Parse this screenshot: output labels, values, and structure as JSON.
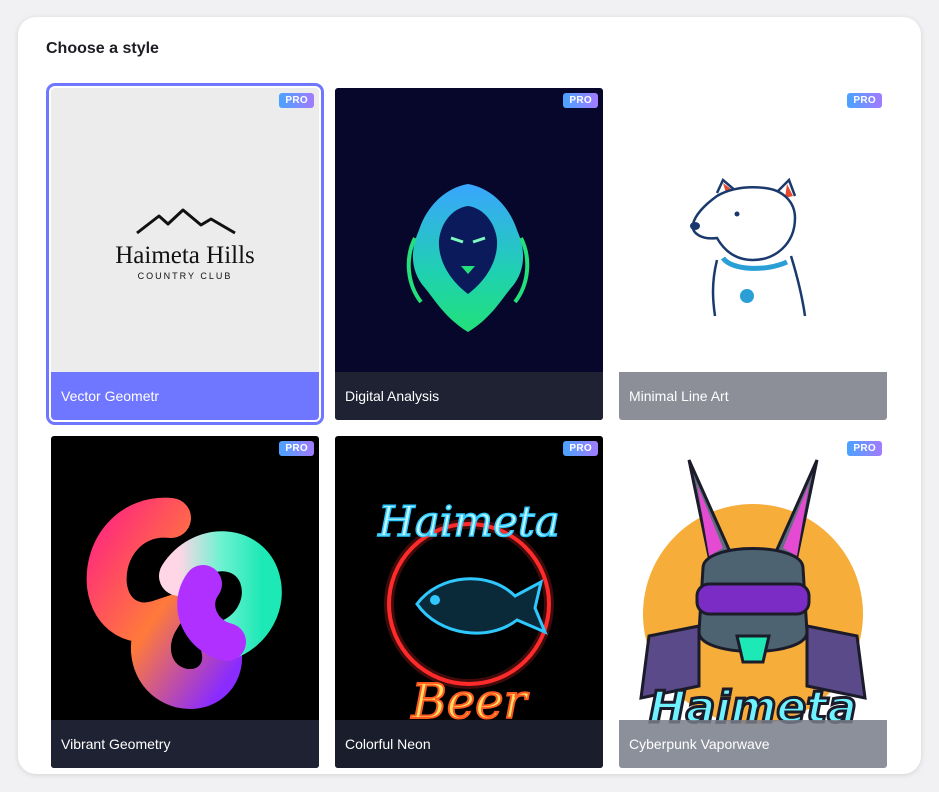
{
  "header": {
    "title": "Choose a style"
  },
  "badge": "PRO",
  "styles": [
    {
      "label": "Vector Geometr",
      "pro": true,
      "selected": true,
      "art_text_1": "Haimeta Hills",
      "art_text_2": "COUNTRY CLUB"
    },
    {
      "label": "Digital Analysis",
      "pro": true,
      "selected": false
    },
    {
      "label": "Minimal Line Art",
      "pro": true,
      "selected": false
    },
    {
      "label": "Vibrant Geometry",
      "pro": true,
      "selected": false
    },
    {
      "label": "Colorful Neon",
      "pro": true,
      "selected": false,
      "art_text_1": "Haimeta",
      "art_text_2": "Beer"
    },
    {
      "label": "Cyberpunk Vaporwave",
      "pro": true,
      "selected": false,
      "art_text_1": "Haimeta"
    }
  ],
  "colors": {
    "selected_outline": "#6f76ff",
    "selected_label_bg": "#6f76ff",
    "dark_label_bg": "#1f2233",
    "grey_label_bg": "#8c8f98"
  }
}
